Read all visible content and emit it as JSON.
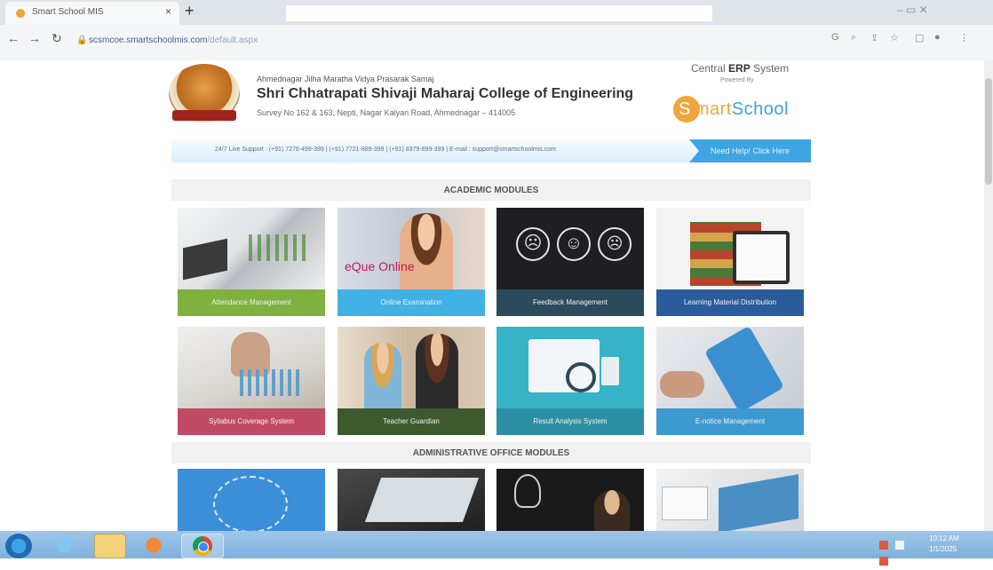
{
  "browser": {
    "tab_title": "Smart School MIS",
    "tab_close": "×",
    "new_tab": "+",
    "url_host": "scsmcoe.smartschoolmis.com",
    "url_path": "/default.aspx",
    "window_controls": "–  ▭  ✕"
  },
  "header": {
    "org_line": "Ahmednagar Jilha Maratha Vidya Prasarak Samaj",
    "college_name": "Shri Chhatrapati Shivaji Maharaj College of Engineering",
    "address": "Survey No 162 & 163, Nepti, Nagar Kalyan Road, Ahmednagar – 414005",
    "erp_prefix": "Central",
    "erp_bold": "ERP",
    "erp_suffix": "System",
    "powered_by": "Powered By",
    "brand_smart": "mart",
    "brand_school": "School"
  },
  "support": {
    "text": "24/7 Live Support : (+91) 7276-499-399 | (+91) 7721-889-399 | (+91) 8379-899-399 | E-mail : support@smartschoolmis.com",
    "help_label": "Need Help! Click Here"
  },
  "sections": {
    "academic": "ACADEMIC MODULES",
    "admin": "ADMINISTRATIVE OFFICE MODULES"
  },
  "academic_tiles": [
    {
      "label": "Attendance Management",
      "color": "#7fb13f"
    },
    {
      "label": "Online Examination",
      "color": "#41b0e4"
    },
    {
      "label": "Feedback Management",
      "color": "#2b4a5c"
    },
    {
      "label": "Learning Material Distribution",
      "color": "#2a5b9b"
    },
    {
      "label": "Syllabus Coverage System",
      "color": "#c14b63"
    },
    {
      "label": "Teacher Guardian",
      "color": "#3d5a2f"
    },
    {
      "label": "Result Analysis System",
      "color": "#2d8fa3"
    },
    {
      "label": "E-notice Management",
      "color": "#3d9ad1"
    }
  ],
  "equeue_label": "eQue Online",
  "taskbar": {
    "time": "10:12 AM",
    "date": "1/1/2025"
  }
}
